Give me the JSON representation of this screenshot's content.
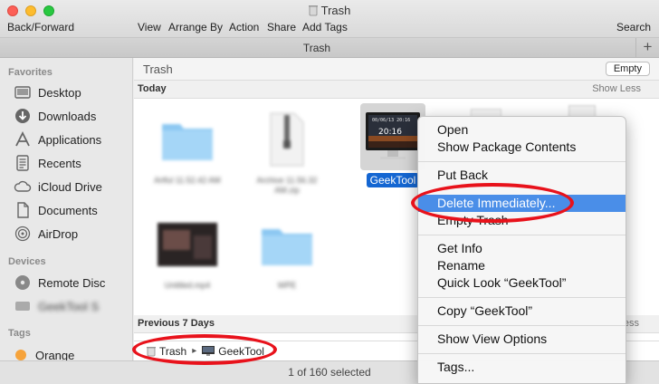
{
  "window": {
    "title": "Trash"
  },
  "toolbar": {
    "back_forward": "Back/Forward",
    "view": "View",
    "arrange_by": "Arrange By",
    "action": "Action",
    "share": "Share",
    "add_tags": "Add Tags",
    "search": "Search"
  },
  "tab": {
    "title": "Trash",
    "add_symbol": "+"
  },
  "sidebar": {
    "favorites_header": "Favorites",
    "favorites": [
      {
        "label": "Desktop",
        "icon": "desktop-icon"
      },
      {
        "label": "Downloads",
        "icon": "downloads-icon"
      },
      {
        "label": "Applications",
        "icon": "applications-icon"
      },
      {
        "label": "Recents",
        "icon": "recents-icon"
      },
      {
        "label": "iCloud Drive",
        "icon": "icloud-icon"
      },
      {
        "label": "Documents",
        "icon": "documents-icon"
      },
      {
        "label": "AirDrop",
        "icon": "airdrop-icon"
      }
    ],
    "devices_header": "Devices",
    "devices": [
      {
        "label": "Remote Disc",
        "icon": "disc-icon"
      },
      {
        "label": "GeekTool S",
        "icon": "disk-icon",
        "blurred": true
      }
    ],
    "tags_header": "Tags",
    "tags": [
      {
        "label": "Orange",
        "color": "#f6a33b"
      }
    ]
  },
  "main": {
    "path_title": "Trash",
    "empty_button": "Empty",
    "group_today": "Today",
    "show_less": "Show Less",
    "group_prev": "Previous 7 Days",
    "show_less_prev": "ess",
    "files": [
      {
        "label": "Artful 11.52.42 AM",
        "kind": "folder"
      },
      {
        "label": "Archive 11.56.32 AM.zip",
        "kind": "zip"
      },
      {
        "label": "GeekTool",
        "kind": "app",
        "selected": true,
        "screen_date": "00/06/13 20:16",
        "screen_time": "20:16"
      },
      {
        "label": "Untitled.mp4",
        "kind": "video"
      },
      {
        "label": "WPE",
        "kind": "folder"
      }
    ]
  },
  "pathbar": {
    "crumbs": [
      "Trash",
      "GeekTool"
    ]
  },
  "status": {
    "text": "1 of 160 selected"
  },
  "context_menu": {
    "items": [
      "Open",
      "Show Package Contents",
      "Put Back",
      "Delete Immediately...",
      "Empty Trash",
      "Get Info",
      "Rename",
      "Quick Look “GeekTool”",
      "Copy “GeekTool”",
      "Show View Options",
      "Tags..."
    ],
    "highlighted_index": 3
  },
  "colors": {
    "selection": "#1466d2",
    "menu_highlight": "#4a8ee8",
    "annotation": "#e8121b",
    "folder": "#8cc8f2"
  }
}
